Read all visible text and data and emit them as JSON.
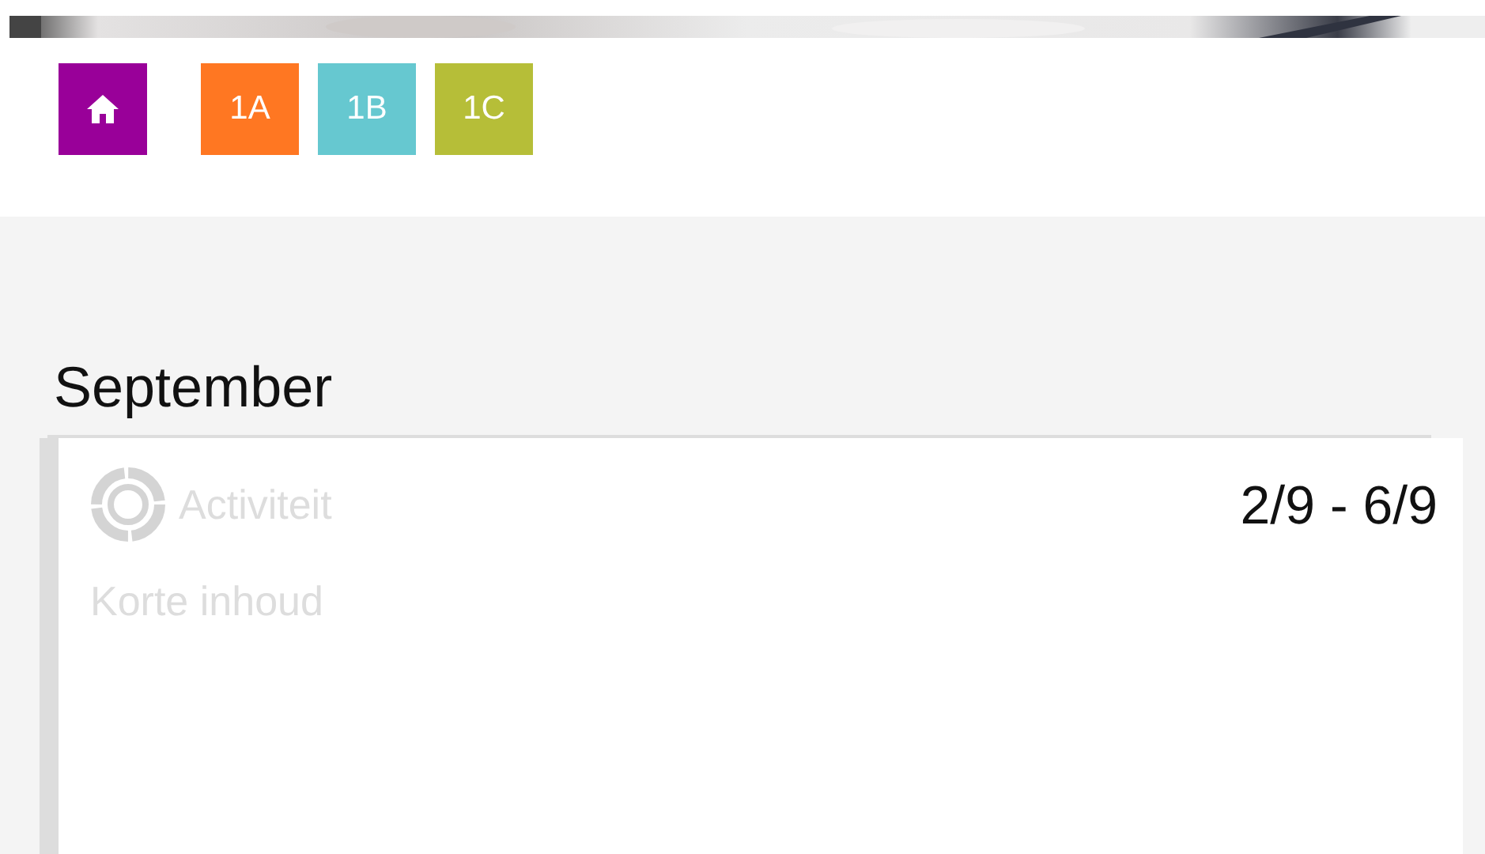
{
  "nav": {
    "home": {
      "color": "#990099"
    },
    "tiles": [
      {
        "label": "1A",
        "color": "#ff7722"
      },
      {
        "label": "1B",
        "color": "#66c8d0"
      },
      {
        "label": "1C",
        "color": "#b6be38"
      }
    ]
  },
  "month": "September",
  "events": [
    {
      "type": "Activiteit",
      "date": "2/9 - 6/9",
      "summary": "Korte inhoud"
    }
  ]
}
